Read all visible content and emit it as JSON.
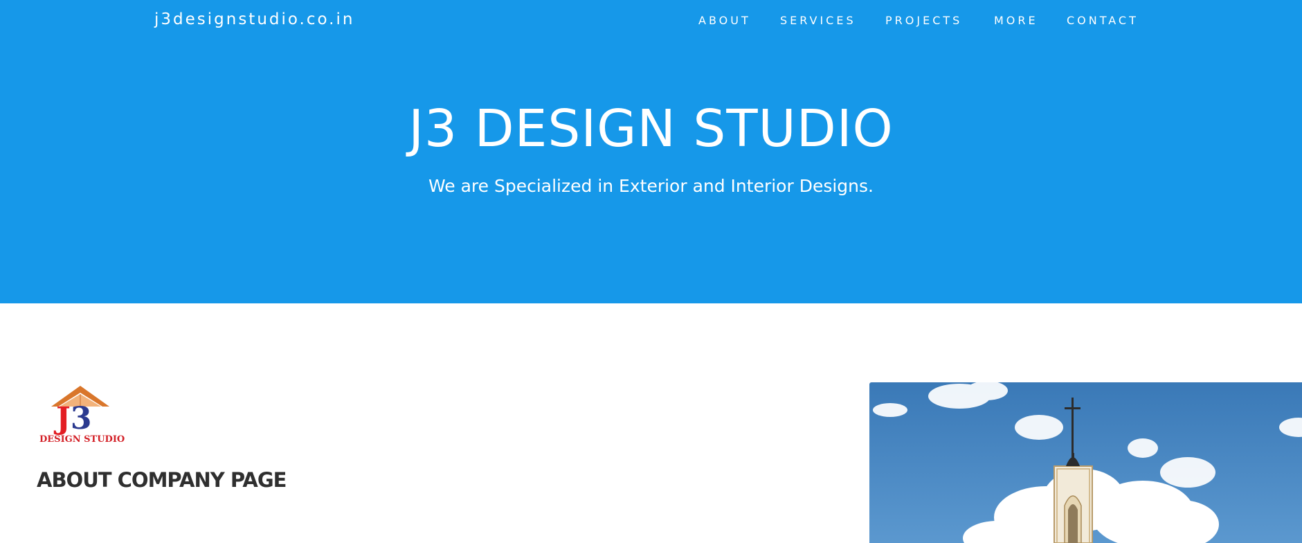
{
  "header": {
    "brand": "j3designstudio.co.in",
    "nav": [
      {
        "label": "ABOUT"
      },
      {
        "label": "SERVICES"
      },
      {
        "label": "PROJECTS"
      },
      {
        "label": "MORE"
      },
      {
        "label": "CONTACT"
      }
    ]
  },
  "hero": {
    "title": "J3 DESIGN STUDIO",
    "subtitle": "We are Specialized in Exterior and Interior Designs."
  },
  "about": {
    "logo": {
      "mark": "J3",
      "caption": "DESIGN STUDIO"
    },
    "heading": "ABOUT COMPANY PAGE",
    "image_subject": "church-tower-photo"
  },
  "colors": {
    "hero_bg": "#1698e9",
    "heading_text": "#2f2f2f",
    "logo_red": "#e31e24",
    "logo_blue": "#2b3a8f",
    "logo_roof": "#d9762b"
  }
}
